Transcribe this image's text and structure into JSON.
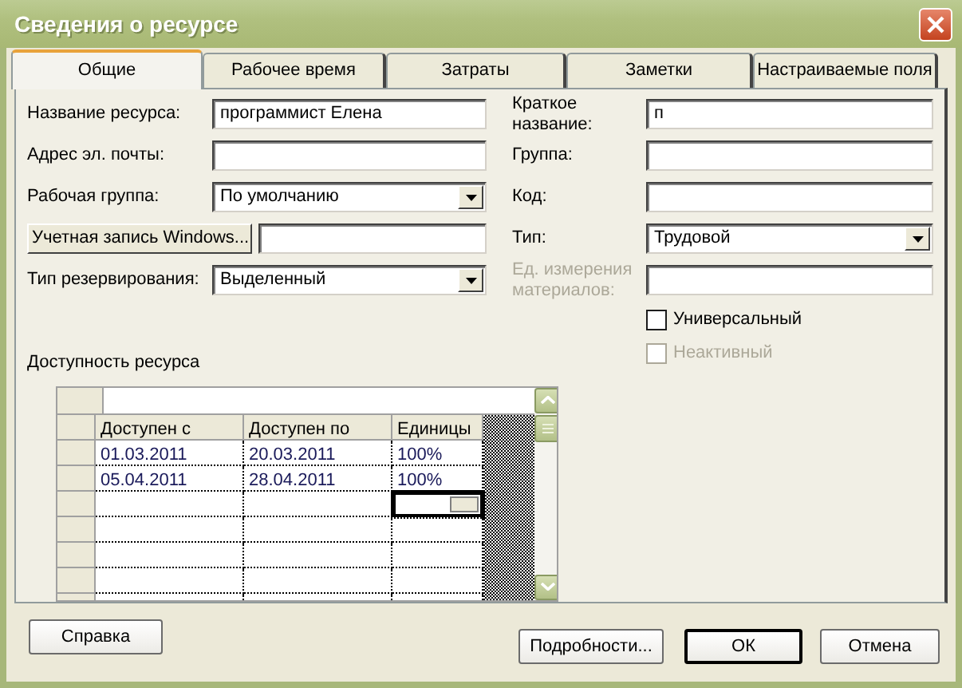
{
  "window": {
    "title": "Сведения о ресурсе"
  },
  "tabs": [
    {
      "label": "Общие",
      "selected": true
    },
    {
      "label": "Рабочее время",
      "selected": false
    },
    {
      "label": "Затраты",
      "selected": false
    },
    {
      "label": "Заметки",
      "selected": false
    },
    {
      "label": "Настраиваемые поля",
      "selected": false
    }
  ],
  "left_fields": [
    {
      "kind": "text",
      "label": "Название ресурса:",
      "value": "программист Елена"
    },
    {
      "kind": "text",
      "label": "Адрес эл. почты:"
    },
    {
      "kind": "select",
      "label": "Рабочая группа:",
      "value": "По умолчанию"
    },
    {
      "kind": "button",
      "label": "Учетная запись Windows..."
    },
    {
      "kind": "select",
      "label": "Тип резервирования:",
      "value": "Выделенный"
    }
  ],
  "right_fields": [
    {
      "kind": "text",
      "label": "Краткое название:",
      "value": "п",
      "disabled": false
    },
    {
      "kind": "text",
      "label": "Группа:",
      "disabled": false
    },
    {
      "kind": "text",
      "label": "Код:",
      "disabled": false
    },
    {
      "kind": "select",
      "label": "Тип:",
      "value": "Трудовой",
      "disabled": false
    },
    {
      "kind": "text",
      "label": "Ед. измерения материалов:",
      "disabled": true
    }
  ],
  "checkboxes": [
    {
      "label": "Универсальный",
      "checked": false,
      "disabled": false
    },
    {
      "label": "Неактивный",
      "checked": false,
      "disabled": true
    }
  ],
  "availability": {
    "label": "Доступность ресурса",
    "columns": [
      "Доступен с",
      "Доступен по",
      "Единицы"
    ],
    "rows": [
      {
        "cells": [
          "01.03.2011",
          "20.03.2011",
          "100%"
        ],
        "editing": false
      },
      {
        "cells": [
          "05.04.2011",
          "28.04.2011",
          "100%"
        ],
        "editing": false
      },
      {
        "editing": true
      }
    ]
  },
  "footer": {
    "help_button": "Справка",
    "buttons": [
      {
        "label": "Подробности...",
        "default": false
      },
      {
        "label": "ОК",
        "default": true
      },
      {
        "label": "Отмена",
        "default": false
      }
    ]
  }
}
